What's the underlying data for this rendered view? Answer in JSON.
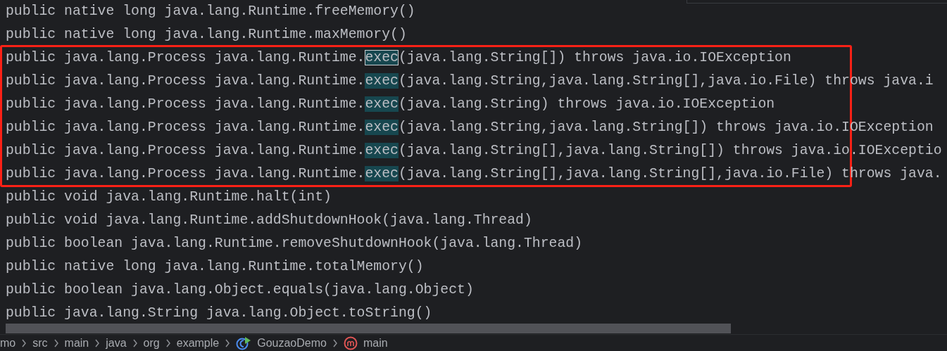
{
  "editor": {
    "lines_before": [
      "public native long java.lang.Runtime.freeMemory()",
      "public native long java.lang.Runtime.maxMemory()"
    ],
    "framed_lines": [
      {
        "before": "public java.lang.Process java.lang.Runtime.",
        "match": "exec",
        "after": "(java.lang.String[]) throws java.io.IOException",
        "current": true
      },
      {
        "before": "public java.lang.Process java.lang.Runtime.",
        "match": "exec",
        "after": "(java.lang.String,java.lang.String[],java.io.File) throws java.i",
        "current": false
      },
      {
        "before": "public java.lang.Process java.lang.Runtime.",
        "match": "exec",
        "after": "(java.lang.String) throws java.io.IOException",
        "current": false
      },
      {
        "before": "public java.lang.Process java.lang.Runtime.",
        "match": "exec",
        "after": "(java.lang.String,java.lang.String[]) throws java.io.IOException",
        "current": false
      },
      {
        "before": "public java.lang.Process java.lang.Runtime.",
        "match": "exec",
        "after": "(java.lang.String[],java.lang.String[]) throws java.io.IOExceptio",
        "current": false
      },
      {
        "before": "public java.lang.Process java.lang.Runtime.",
        "match": "exec",
        "after": "(java.lang.String[],java.lang.String[],java.io.File) throws java.",
        "current": false
      }
    ],
    "lines_after": [
      "public void java.lang.Runtime.halt(int)",
      "public void java.lang.Runtime.addShutdownHook(java.lang.Thread)",
      "public boolean java.lang.Runtime.removeShutdownHook(java.lang.Thread)",
      "public native long java.lang.Runtime.totalMemory()",
      "public boolean java.lang.Object.equals(java.lang.Object)",
      "public java.lang.String java.lang.Object.toString()"
    ]
  },
  "breadcrumbs": [
    {
      "label": "mo",
      "kind": "folder"
    },
    {
      "label": "src",
      "kind": "folder"
    },
    {
      "label": "main",
      "kind": "folder"
    },
    {
      "label": "java",
      "kind": "folder"
    },
    {
      "label": "org",
      "kind": "folder"
    },
    {
      "label": "example",
      "kind": "folder"
    },
    {
      "label": "GouzaoDemo",
      "kind": "class"
    },
    {
      "label": "main",
      "kind": "method"
    }
  ]
}
